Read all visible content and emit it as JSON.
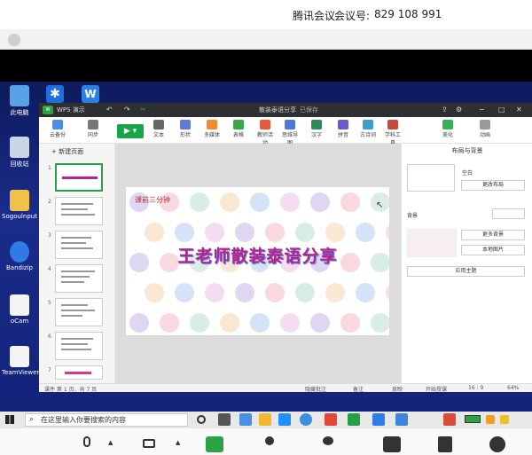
{
  "meeting": {
    "app": "腾讯会议",
    "id_label": "会议号:",
    "id": "829 108 991"
  },
  "desktop": {
    "icons": [
      {
        "label": "此电脑",
        "icon": "computer-icon"
      },
      {
        "label": "回收站",
        "icon": "recycle-bin-icon"
      },
      {
        "label": "Sogoulnput",
        "icon": "folder-icon"
      },
      {
        "label": "Bandizip",
        "icon": "bandizip-icon"
      },
      {
        "label": "oCam",
        "icon": "file-icon"
      },
      {
        "label": "TeamViewer",
        "icon": "file-icon"
      }
    ]
  },
  "app": {
    "tab": "WPS 演示",
    "doc_title": "散装泰语分享",
    "doc_status": "已保存",
    "ribbon": [
      "云备份",
      "同步",
      "文本",
      "形状",
      "多媒体",
      "表格",
      "教师活动",
      "思维导图",
      "汉字",
      "拼音",
      "古诗词",
      "学科工具",
      "美化",
      "动画"
    ],
    "new_slide": "+ 新建页面",
    "slides": [
      "1",
      "2",
      "3",
      "4",
      "5",
      "6",
      "7"
    ],
    "slide": {
      "corner": "课前三分钟",
      "title": "王老师散装泰语分享"
    },
    "right_pane": {
      "title": "布局与背景",
      "layout_label": "空白",
      "change_layout": "更改布局",
      "bg_label": "背景",
      "more_bg": "更多背景",
      "local_image": "本地图片",
      "apply_theme": "应用主题"
    },
    "status": {
      "page": "课件 第 1 页，共 7 页",
      "notes_toggle": "隐藏批注",
      "notes": "备注",
      "playback": "放映",
      "start": "开始授课",
      "ratio": "16 : 9",
      "zoom": "64%"
    }
  },
  "taskbar": {
    "search_placeholder": "在这里输入你要搜索的内容"
  },
  "colors": {
    "accent_green": "#18a447",
    "title_magenta": "#b7228f",
    "desktop_blue": "#13237a"
  }
}
